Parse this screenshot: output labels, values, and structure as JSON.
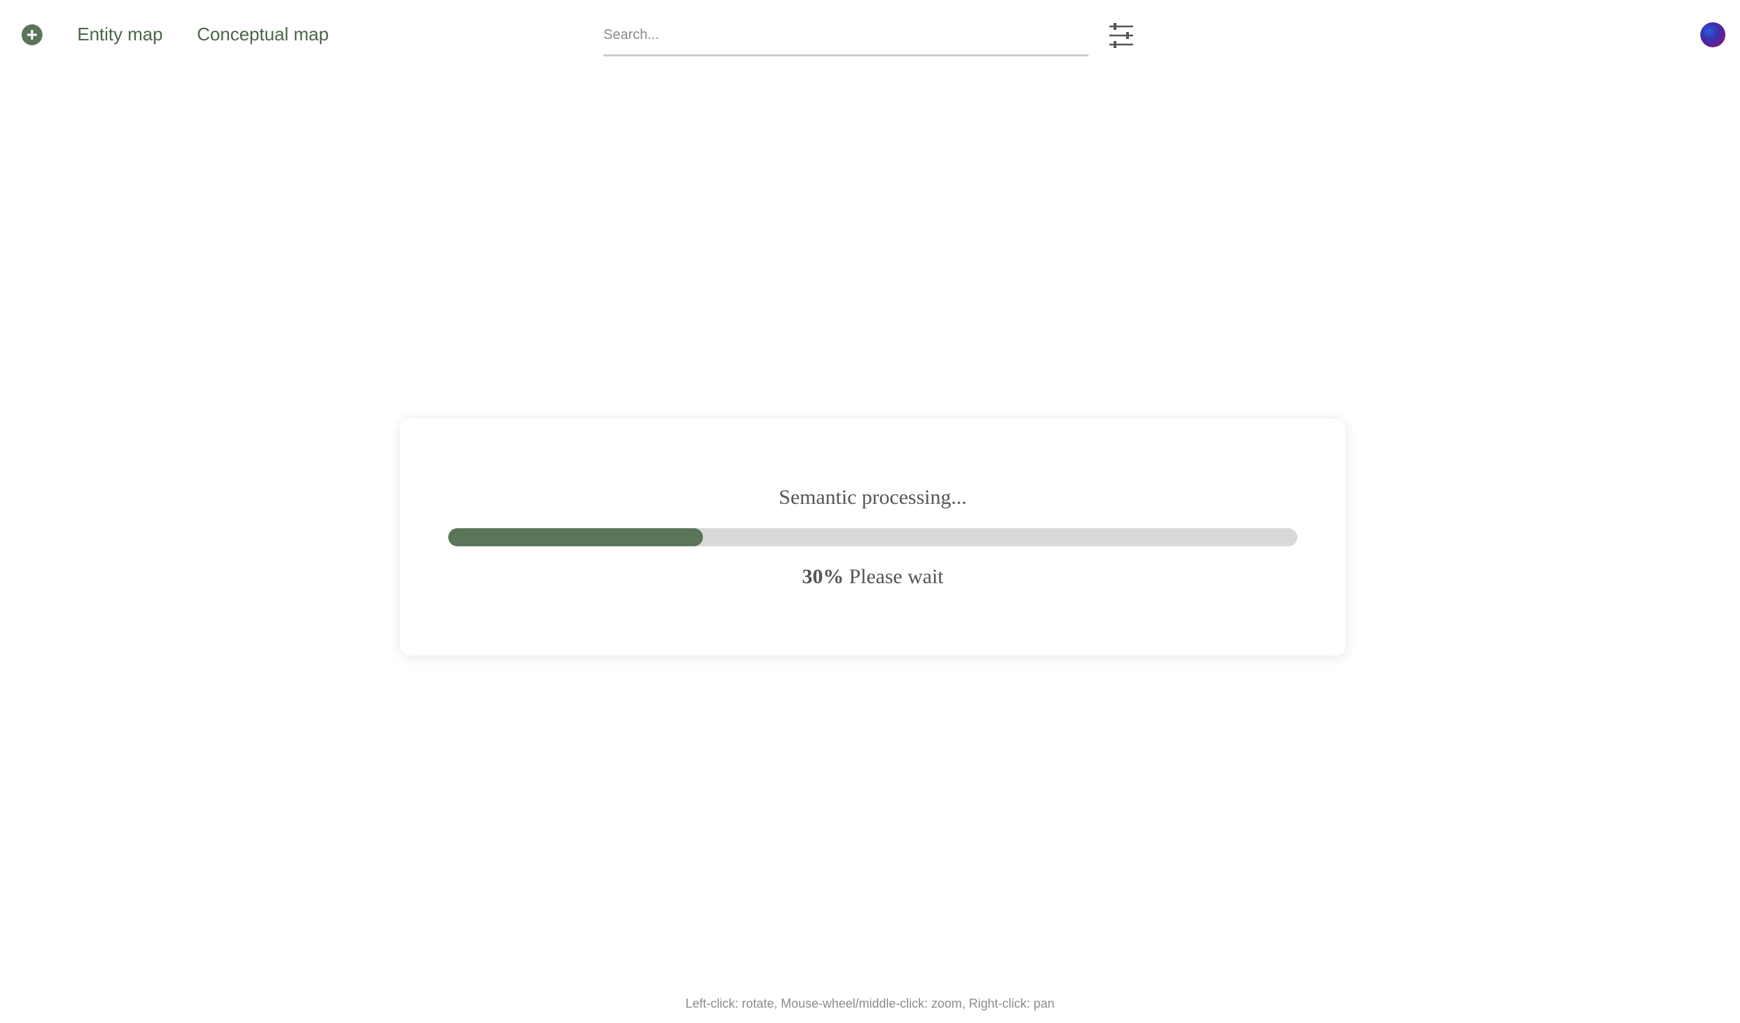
{
  "header": {
    "add_button_icon": "plus-circle-icon",
    "nav": [
      {
        "label": "Entity map"
      },
      {
        "label": "Conceptual map"
      }
    ],
    "search": {
      "placeholder": "Search...",
      "value": ""
    },
    "filter_icon": "sliders-icon",
    "avatar_icon": "user-avatar"
  },
  "dialog": {
    "title": "Semantic processing...",
    "progress_percent": 30,
    "progress_label": "30%",
    "status_text": " Please wait"
  },
  "footer": {
    "hint": "Left-click: rotate, Mouse-wheel/middle-click: zoom, Right-click: pan"
  },
  "colors": {
    "accent": "#5a7558",
    "nav_text": "#4a6647",
    "track": "#d9d9d9"
  }
}
